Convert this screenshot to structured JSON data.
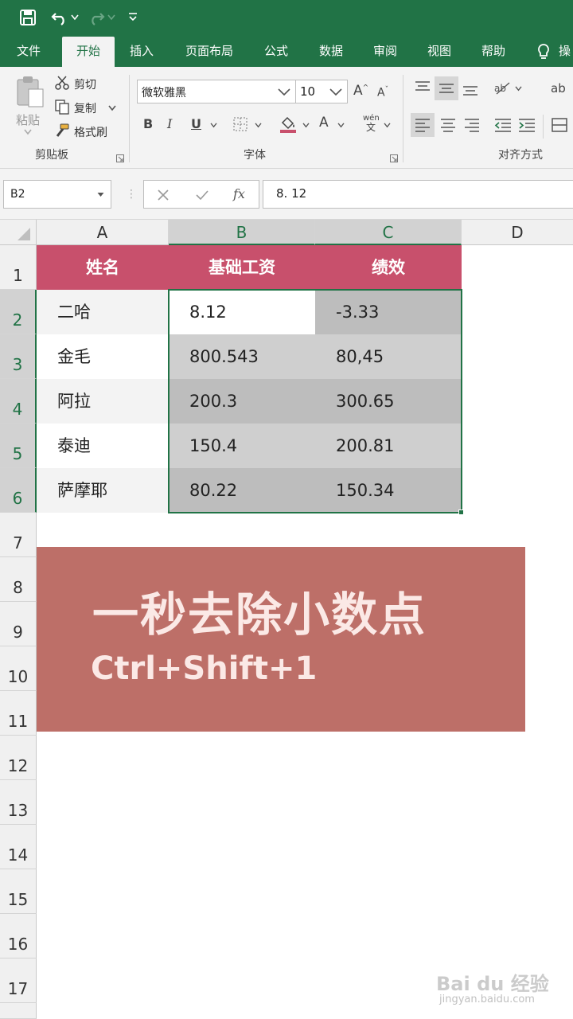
{
  "ribbon_tabs": [
    {
      "label": "文件"
    },
    {
      "label": "开始"
    },
    {
      "label": "插入"
    },
    {
      "label": "页面布局"
    },
    {
      "label": "公式"
    },
    {
      "label": "数据"
    },
    {
      "label": "审阅"
    },
    {
      "label": "视图"
    },
    {
      "label": "帮助"
    },
    {
      "label": "操"
    }
  ],
  "clipboard": {
    "paste": "粘贴",
    "cut": "剪切",
    "copy": "复制",
    "format_painter": "格式刷",
    "group_label": "剪贴板"
  },
  "font": {
    "name": "微软雅黑",
    "size": "10",
    "bold": "B",
    "italic": "I",
    "underline": "U",
    "font_color_letter": "A",
    "wen": "wén",
    "wen2": "文",
    "group_label": "字体"
  },
  "alignment": {
    "group_label": "对齐方式",
    "wrap": "ab"
  },
  "formula_bar": {
    "name_box": "B2",
    "fx": "fx",
    "value": "8. 12"
  },
  "columns": [
    {
      "label": "A"
    },
    {
      "label": "B"
    },
    {
      "label": "C"
    },
    {
      "label": "D"
    }
  ],
  "rows": [
    "1",
    "2",
    "3",
    "4",
    "5",
    "6",
    "7",
    "8",
    "9",
    "10",
    "11",
    "12",
    "13",
    "14",
    "15",
    "16",
    "17"
  ],
  "table": {
    "headers": [
      "姓名",
      "基础工资",
      "绩效"
    ],
    "rows": [
      [
        "二哈",
        "8.12",
        "-3.33"
      ],
      [
        "金毛",
        "800.543",
        "80,45"
      ],
      [
        "阿拉",
        "200.3",
        "300.65"
      ],
      [
        "泰迪",
        "150.4",
        "200.81"
      ],
      [
        "萨摩耶",
        "80.22",
        "150.34"
      ]
    ]
  },
  "banner": {
    "title": "一秒去除小数点",
    "subtitle": "Ctrl+Shift+1"
  },
  "watermark": {
    "logo": "Bai du 经验",
    "url": "jingyan.baidu.com"
  },
  "colors": {
    "excel_green": "#217346",
    "header_fill": "#c8506c",
    "banner_fill": "#bd6f68",
    "selection_gray": "#c6c6c6"
  }
}
